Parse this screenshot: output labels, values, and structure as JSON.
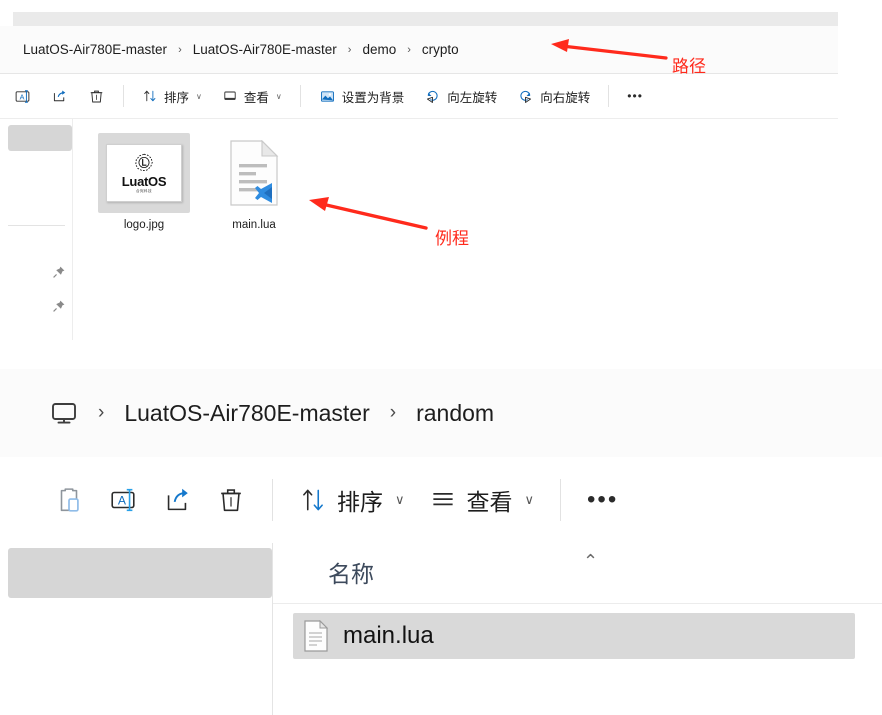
{
  "top_window": {
    "breadcrumb": {
      "name": "address-breadcrumb",
      "items": [
        "LuatOS-Air780E-master",
        "LuatOS-Air780E-master",
        "demo",
        "crypto"
      ],
      "separator": "›"
    },
    "toolbar": {
      "rename_label": "",
      "share_label": "",
      "delete_label": "",
      "sort_label": "排序",
      "view_label": "查看",
      "set_background_label": "设置为背景",
      "rotate_left_label": "向左旋转",
      "rotate_right_label": "向右旋转",
      "more_label": "•••",
      "chevron": "∨"
    },
    "files": [
      {
        "name": "logo.jpg",
        "type": "image",
        "selected": true,
        "thumb_title": "LuatOS",
        "thumb_subtitle": "合宛科技"
      },
      {
        "name": "main.lua",
        "type": "lua-document",
        "selected": false
      }
    ]
  },
  "annotations": [
    {
      "text": "路径",
      "color": "#ff2a1c"
    },
    {
      "text": "例程",
      "color": "#ff2a1c"
    }
  ],
  "bottom_window": {
    "breadcrumb": {
      "items": [
        "LuatOS-Air780E-master",
        "random"
      ],
      "separator": "›",
      "root_icon": "monitor-icon"
    },
    "toolbar": {
      "paste_label": "",
      "rename_label": "",
      "share_label": "",
      "delete_label": "",
      "sort_label": "排序",
      "view_label": "查看",
      "more_label": "•••",
      "chevron": "∨"
    },
    "columns": [
      {
        "label": "名称",
        "sort": "ascending",
        "caret": "⌃"
      }
    ],
    "rows": [
      {
        "name": "main.lua",
        "type": "document",
        "selected": true
      }
    ]
  }
}
